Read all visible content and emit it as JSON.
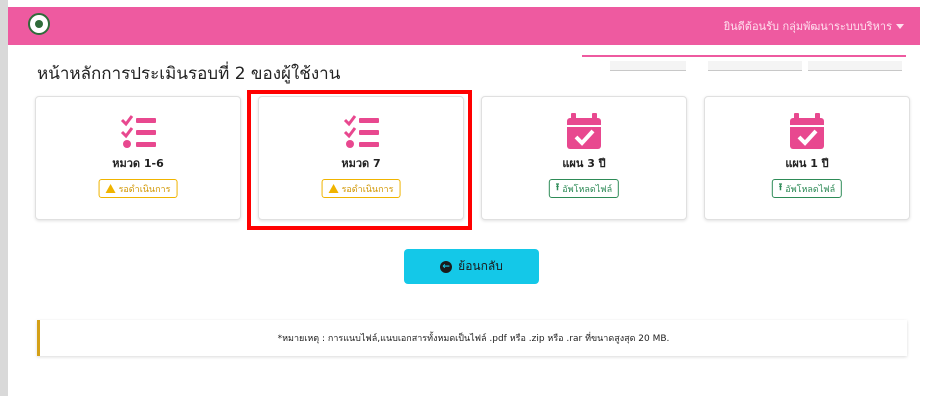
{
  "header": {
    "user_menu": "ยินดีต้อนรับ กลุ่มพัฒนาระบบบริหาร",
    "brand_color": "#ee5aa0"
  },
  "page": {
    "title": "หน้าหลักการประเมินรอบที่ 2 ของผู้ใช้งาน"
  },
  "cards": [
    {
      "label": "หมวด 1-6",
      "icon": "checklist-icon",
      "action": "รอดำเนินการ",
      "action_type": "pending"
    },
    {
      "label": "หมวด 7",
      "icon": "checklist-icon",
      "action": "รอดำเนินการ",
      "action_type": "pending"
    },
    {
      "label": "แผน 3 ปี",
      "icon": "calendar-check-icon",
      "action": "อัพโหลดไฟล์",
      "action_type": "upload"
    },
    {
      "label": "แผน 1 ปี",
      "icon": "calendar-check-icon",
      "action": "อัพโหลดไฟล์",
      "action_type": "upload"
    }
  ],
  "back_button": {
    "label": "ย้อนกลับ"
  },
  "note": "*หมายเหตุ : การแนบไฟล์,แนบเอกสารทั้งหมดเป็นไฟล์ .pdf หรือ .zip หรือ .rar ที่ขนาดสูงสุด 20 MB."
}
